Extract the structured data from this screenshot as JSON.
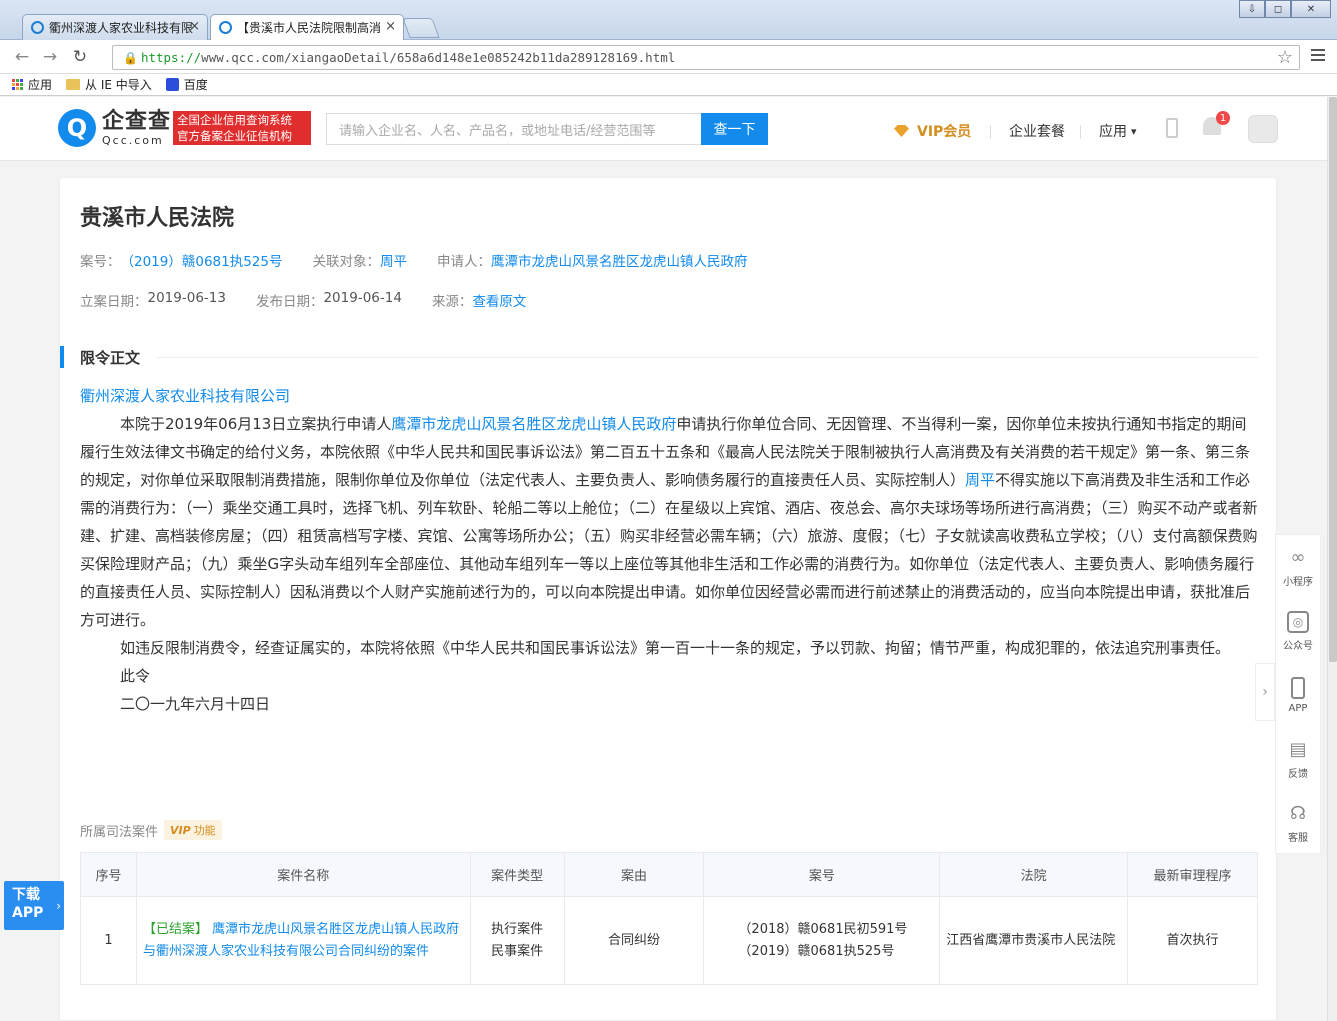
{
  "browser": {
    "tabs": [
      {
        "title": "衢州深渡人家农业科技有限",
        "close": "×"
      },
      {
        "title": "【贵溪市人民法院限制高消",
        "close": "×"
      }
    ],
    "window_buttons": {
      "minimize": "⇩",
      "restore": "◻",
      "close": "✕"
    },
    "back": "←",
    "forward": "→",
    "reload": "↻",
    "url_scheme": "https://",
    "url_rest": "www.qcc.com/xiangaoDetail/658a6d148e1e085242b11da289128169.html",
    "star": "☆",
    "bookmarks": [
      {
        "icon": "apps-icon",
        "label": "应用"
      },
      {
        "icon": "folder-icon",
        "label": "从 IE 中导入"
      },
      {
        "icon": "baidu-icon",
        "label": "百度"
      }
    ]
  },
  "site": {
    "logo_cn": "企查查",
    "logo_en": "Qcc.com",
    "slogan_line1": "全国企业信用查询系统",
    "slogan_line2": "官方备案企业征信机构",
    "search_placeholder": "请输入企业名、人名、产品名，或地址电话/经营范围等",
    "search_button": "查一下",
    "nav": {
      "vip": "VIP会员",
      "package": "企业套餐",
      "apps": "应用",
      "apps_caret": "▾"
    },
    "notification_count": "1"
  },
  "detail": {
    "title": "贵溪市人民法院",
    "case_no_label": "案号：",
    "case_no": "（2019）赣0681执525号",
    "related_label": "关联对象：",
    "related": "周平",
    "applicant_label": "申请人：",
    "applicant": "鹰潭市龙虎山风景名胜区龙虎山镇人民政府",
    "filed_label": "立案日期：",
    "filed": "2019-06-13",
    "published_label": "发布日期：",
    "published": "2019-06-14",
    "source_label": "来源：",
    "source_link": "查看原文"
  },
  "document": {
    "section_title": "限令正文",
    "company": "衢州深渡人家农业科技有限公司",
    "p1_a": "本院于2019年06月13日立案执行申请人",
    "p1_applicant": "鹰潭市龙虎山风景名胜区龙虎山镇人民政府",
    "p1_b": "申请执行你单位合同、无因管理、不当得利一案，因你单位未按执行通知书指定的期间履行生效法律文书确定的给付义务，本院依照《中华人民共和国民事诉讼法》第二百五十五条和《最高人民法院关于限制被执行人高消费及有关消费的若干规定》第一条、第三条的规定，对你单位采取限制消费措施，限制你单位及你单位（法定代表人、主要负责人、影响债务履行的直接责任人员、实际控制人）",
    "p1_person": "周平",
    "p1_c": "不得实施以下高消费及非生活和工作必需的消费行为：（一）乘坐交通工具时，选择飞机、列车软卧、轮船二等以上舱位；（二）在星级以上宾馆、酒店、夜总会、高尔夫球场等场所进行高消费；（三）购买不动产或者新建、扩建、高档装修房屋；（四）租赁高档写字楼、宾馆、公寓等场所办公；（五）购买非经营必需车辆；（六）旅游、度假；（七）子女就读高收费私立学校；（八）支付高额保费购买保险理财产品；（九）乘坐G字头动车组列车全部座位、其他动车组列车一等以上座位等其他非生活和工作必需的消费行为。如你单位（法定代表人、主要负责人、影响债务履行的直接责任人员、实际控制人）因私消费以个人财产实施前述行为的，可以向本院提出申请。如你单位因经营必需而进行前述禁止的消费活动的，应当向本院提出申请，获批准后方可进行。",
    "p2": "如违反限制消费令，经查证属实的，本院将依照《中华人民共和国民事诉讼法》第一百一十一条的规定，予以罚款、拘留；情节严重，构成犯罪的，依法追究刑事责任。",
    "p3": "此令",
    "p4": "二〇一九年六月十四日"
  },
  "related_cases": {
    "title": "所属司法案件",
    "vip_tag_vip": "VIP",
    "vip_tag_text": "功能",
    "headers": [
      "序号",
      "案件名称",
      "案件类型",
      "案由",
      "案号",
      "法院",
      "最新审理程序"
    ],
    "rows": [
      {
        "index": "1",
        "status": "【已结案】",
        "name": "鹰潭市龙虎山风景名胜区龙虎山镇人民政府与衢州深渡人家农业科技有限公司合同纠纷的案件",
        "type_1": "执行案件",
        "type_2": "民事案件",
        "cause": "合同纠纷",
        "case_no_1": "（2018）赣0681民初591号",
        "case_no_2": "（2019）赣0681执525号",
        "court": "江西省鹰潭市贵溪市人民法院",
        "procedure": "首次执行"
      }
    ]
  },
  "side_tools": [
    {
      "icon": "mini-program-icon",
      "glyph": "∞",
      "label": "小程序"
    },
    {
      "icon": "wechat-official-icon",
      "glyph": "◎",
      "label": "公众号"
    },
    {
      "icon": "app-icon",
      "glyph": "",
      "label": "APP"
    },
    {
      "icon": "feedback-icon",
      "glyph": "▤",
      "label": "反馈"
    },
    {
      "icon": "customer-service-icon",
      "glyph": "☊",
      "label": "客服"
    }
  ],
  "collapse_chevron": "›",
  "download_app": {
    "line1": "下载",
    "line2": "APP",
    "chevron": "›"
  }
}
